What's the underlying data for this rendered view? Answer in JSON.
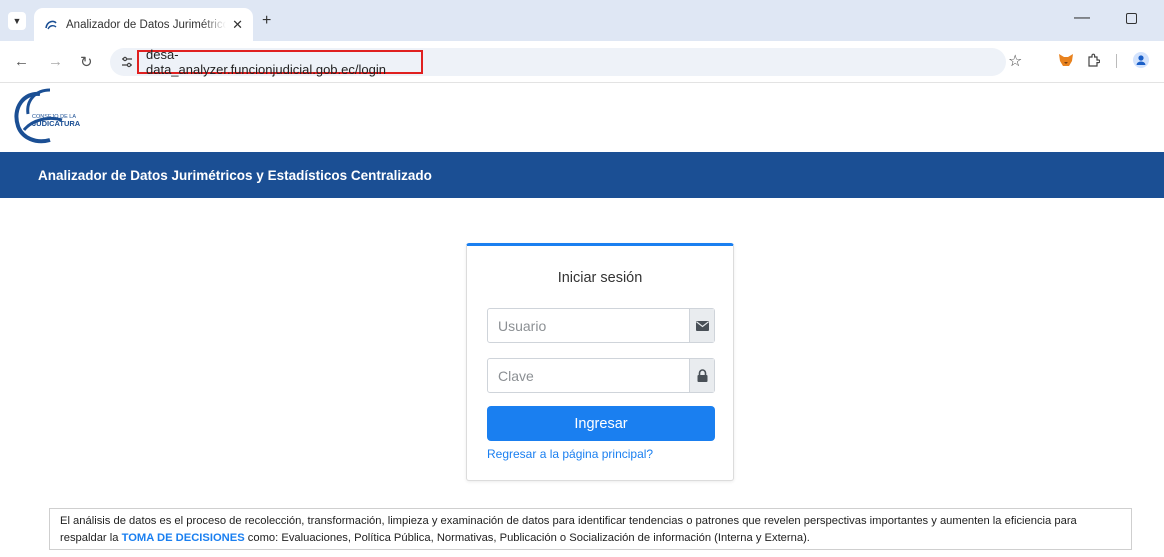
{
  "browser": {
    "tab_title": "Analizador de Datos Jurimétricos y Estadísticos Centralizado",
    "tab_close": "✕",
    "new_tab": "+",
    "url": "desa-data_analyzer.funcionjudicial.gob.ec/login"
  },
  "page": {
    "logo_text_1": "CONSEJO DE LA",
    "logo_text_2": "JUDICATURA",
    "banner_title": "Analizador de Datos Jurimétricos y Estadísticos Centralizado"
  },
  "login": {
    "title": "Iniciar sesión",
    "user_placeholder": "Usuario",
    "password_placeholder": "Clave",
    "submit_label": "Ingresar",
    "back_link": "Regresar a la página principal?"
  },
  "info": {
    "text_before": "El análisis de datos es el proceso de recolección, transformación, limpieza y examinación de datos para identificar tendencias o patrones que revelen perspectivas importantes y aumenten la eficiencia para respaldar la ",
    "text_strong": "TOMA DE DECISIONES",
    "text_after": " como: Evaluaciones, Política Pública, Normativas, Publicación o Socialización de información (Interna y Externa)."
  },
  "colors": {
    "banner": "#1b4f94",
    "primary": "#1a7ff0",
    "url_highlight": "#e02020"
  }
}
